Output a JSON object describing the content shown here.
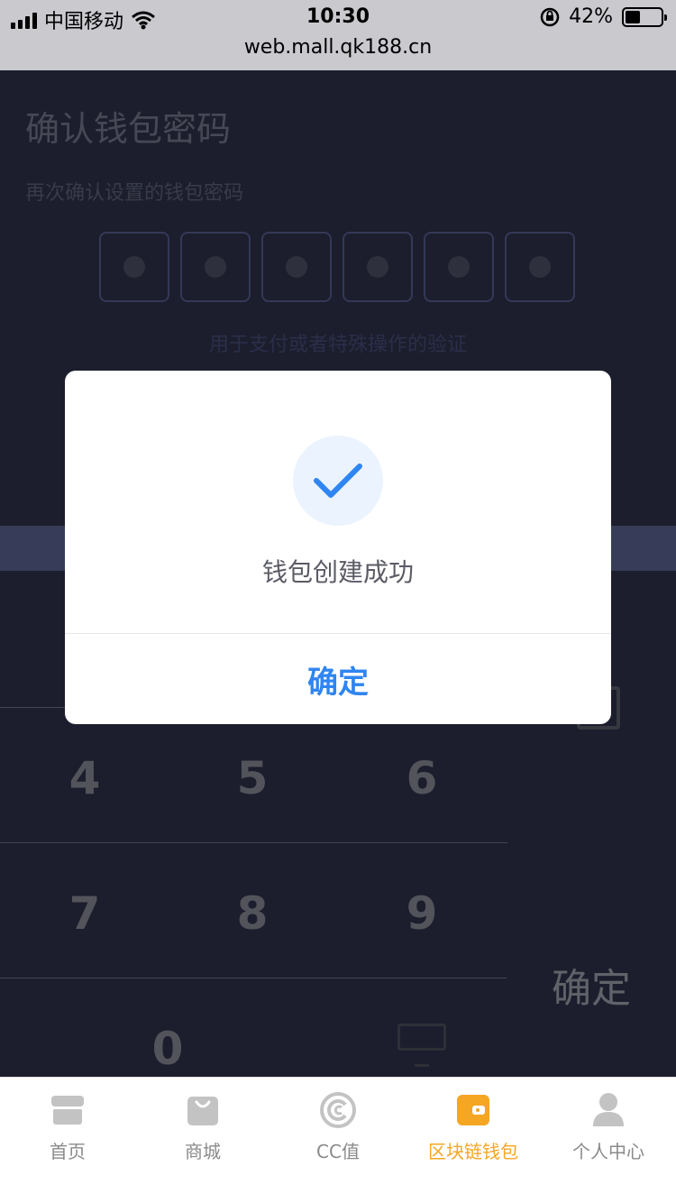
{
  "status_bar": {
    "carrier": "中国移动",
    "time": "10:30",
    "battery": "42%",
    "battery_level": 0.42
  },
  "url_bar": {
    "url": "web.mall.qk188.cn"
  },
  "page": {
    "title": "确认钱包密码",
    "subtitle": "再次确认设置的钱包密码",
    "pin_filled_count": 6,
    "pin_hint": "用于支付或者特殊操作的验证"
  },
  "keypad": {
    "keys": [
      "4",
      "5",
      "6",
      "7",
      "8",
      "9",
      "0"
    ],
    "confirm_label": "确定",
    "delete_icon": "backspace-icon",
    "hide_icon": "keyboard-hide-icon"
  },
  "dialog": {
    "icon": "checkmark-icon",
    "message": "钱包创建成功",
    "confirm_label": "确定",
    "accent_color": "#2f85f1"
  },
  "tab_bar": {
    "active_color": "#f5a623",
    "items": [
      {
        "label": "首页",
        "icon": "home-icon"
      },
      {
        "label": "商城",
        "icon": "shopping-bag-icon"
      },
      {
        "label": "CC值",
        "icon": "cc-coin-icon"
      },
      {
        "label": "区块链钱包",
        "icon": "wallet-icon",
        "active": true
      },
      {
        "label": "个人中心",
        "icon": "user-icon"
      }
    ]
  }
}
